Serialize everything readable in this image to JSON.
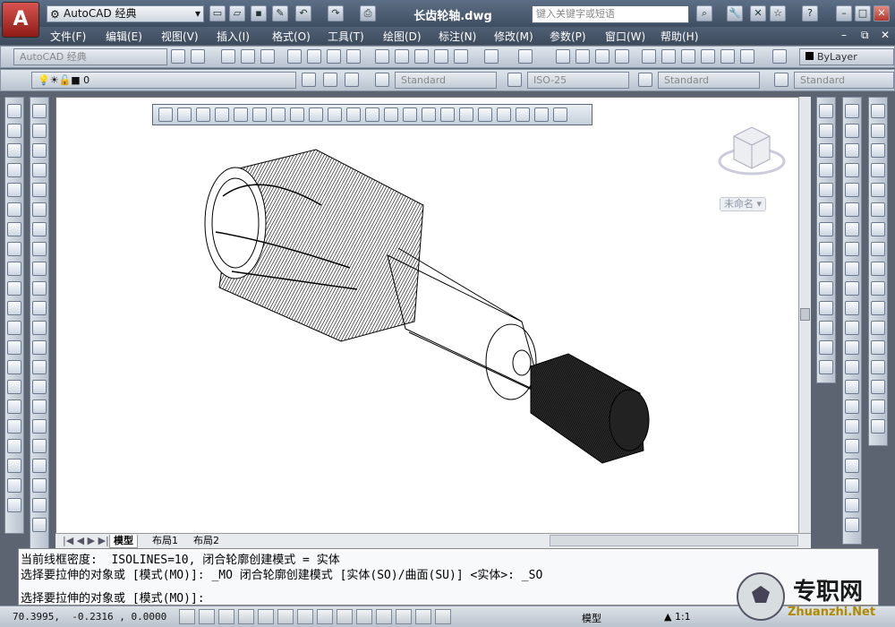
{
  "titlebar": {
    "app_icon": "A",
    "workspace": "AutoCAD 经典",
    "doc_title": "长齿轮轴.dwg",
    "search_placeholder": "键入关键字或短语",
    "help": "?"
  },
  "menu": [
    "文件(F)",
    "编辑(E)",
    "视图(V)",
    "插入(I)",
    "格式(O)",
    "工具(T)",
    "绘图(D)",
    "标注(N)",
    "修改(M)",
    "参数(P)",
    "窗口(W)",
    "帮助(H)"
  ],
  "toolbar1": {
    "workspace_combo": "AutoCAD 经典",
    "bylayer": "ByLayer"
  },
  "toolbar2": {
    "layer_value": "0",
    "textstyle": "Standard",
    "dimstyle": "ISO-25",
    "tablestyle": "Standard",
    "mlstyle": "Standard"
  },
  "viewcube": {
    "label": "未命名"
  },
  "tabs": [
    "模型",
    "布局1",
    "布局2"
  ],
  "command": {
    "line1": "当前线框密度:  ISOLINES=10, 闭合轮廓创建模式 = 实体",
    "line2": "选择要拉伸的对象或 [模式(MO)]: _MO 闭合轮廓创建模式 [实体(SO)/曲面(SU)] <实体>: _SO",
    "prompt": "选择要拉伸的对象或 [模式(MO)]:"
  },
  "status": {
    "coords": "70.3995,  -0.2316 , 0.0000",
    "model": "模型",
    "scale": "1:1"
  },
  "watermark": {
    "cn": "专职网",
    "en": "Zhuanzhi.Net"
  }
}
